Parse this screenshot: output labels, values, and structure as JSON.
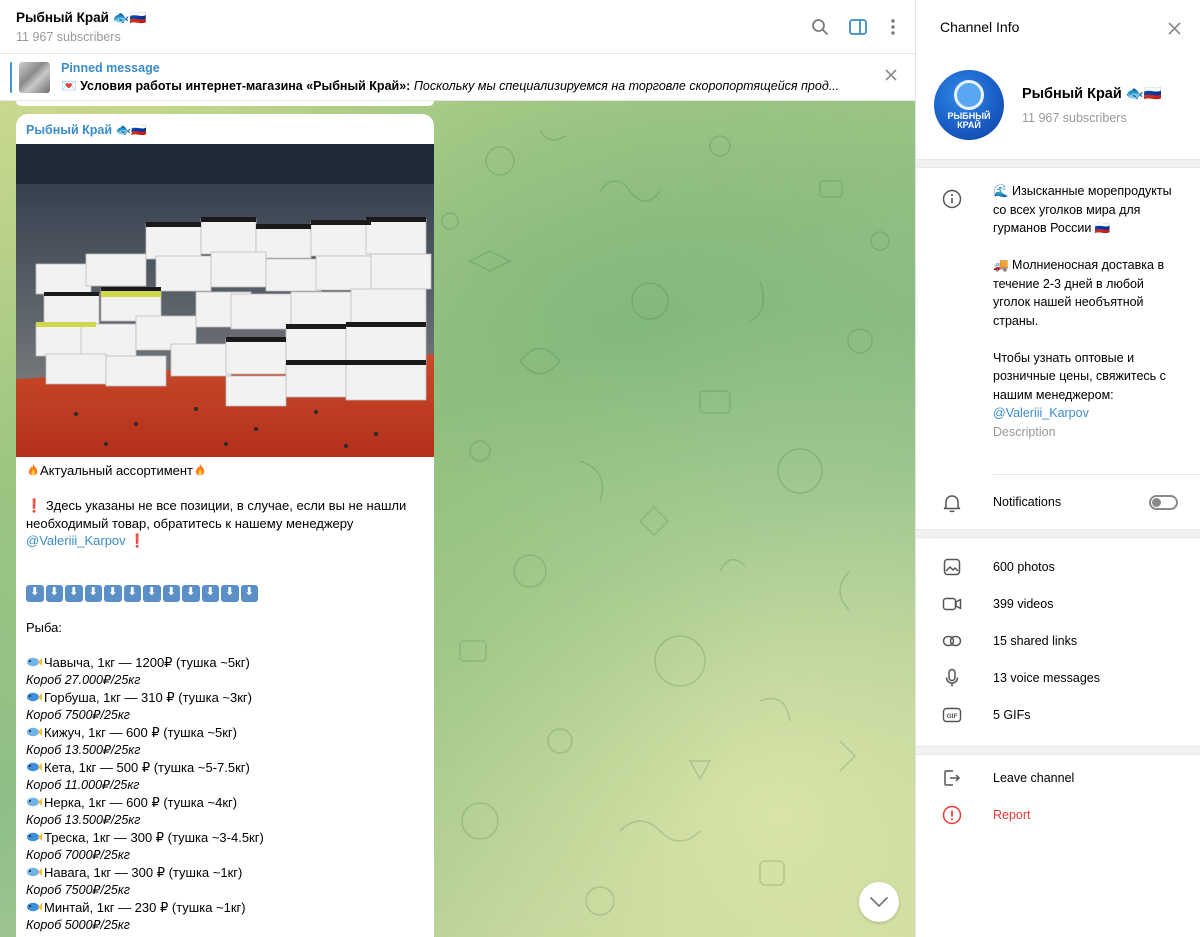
{
  "chat_header": {
    "title": "Рыбный Край 🐟🇷🇺",
    "subscribers": "11 967 subscribers"
  },
  "pinned": {
    "label": "Pinned message",
    "emoji": "💌",
    "bold_text": "Условия работы интернет-магазина «Рыбный Край»:",
    "italic_text": "Поскольку мы специализируемся на торговле скоропортящейся прод..."
  },
  "message": {
    "author": "Рыбный Край 🐟🇷🇺",
    "headline": "Актуальный ассортимент",
    "notice": "Здесь указаны не все позиции, в случае, если вы не нашли необходимый товар, обратитесь к нашему менеджеру",
    "notice_link": "@Valeriii_Karpov",
    "section": "Рыба:",
    "arrow_count": 12,
    "items": [
      {
        "name": "Чавыча, 1кг — 1200₽ (тушка ~5кг)",
        "box": "Короб 27.000₽/25кг"
      },
      {
        "name": "Горбуша, 1кг — 310 ₽ (тушка ~3кг)",
        "box": "Короб 7500₽/25кг"
      },
      {
        "name": "Кижуч, 1кг — 600 ₽ (тушка ~5кг)",
        "box": "Короб 13.500₽/25кг"
      },
      {
        "name": "Кета, 1кг — 500 ₽ (тушка ~5-7.5кг)",
        "box": "Короб 11.000₽/25кг"
      },
      {
        "name": "Нерка, 1кг — 600 ₽ (тушка ~4кг)",
        "box": "Короб 13.500₽/25кг"
      },
      {
        "name": "Треска, 1кг — 300 ₽ (тушка ~3-4.5кг)",
        "box": "Короб 7000₽/25кг"
      },
      {
        "name": "Навага, 1кг — 300 ₽ (тушка ~1кг)",
        "box": "Короб 7500₽/25кг"
      },
      {
        "name": "Минтай, 1кг — 230 ₽ (тушка ~1кг)",
        "box": "Короб 5000₽/25кг"
      }
    ]
  },
  "info_panel": {
    "title": "Channel Info",
    "name": "Рыбный Край 🐟🇷🇺",
    "subscribers": "11 967 subscribers",
    "avatar_text": [
      "РЫБНЫЙ",
      "КРАЙ"
    ],
    "description": {
      "p1": "🌊 Изысканные морепродукты со всех уголков мира для гурманов России 🇷🇺",
      "p2": "🚚 Молниеносная доставка в течение 2-3 дней в любой уголок нашей необъятной страны.",
      "p3": "Чтобы узнать оптовые и розничные цены, свяжитесь с нашим менеджером:",
      "link": "@Valeriii_Karpov",
      "label": "Description"
    },
    "notifications": {
      "label": "Notifications",
      "enabled": false
    },
    "media": [
      {
        "icon": "photo-icon",
        "label": "600 photos"
      },
      {
        "icon": "video-icon",
        "label": "399 videos"
      },
      {
        "icon": "link-icon",
        "label": "15 shared links"
      },
      {
        "icon": "microphone-icon",
        "label": "13 voice messages"
      },
      {
        "icon": "gif-icon",
        "label": "5 GIFs"
      }
    ],
    "actions": {
      "leave": "Leave channel",
      "report": "Report"
    }
  },
  "colors": {
    "accent": "#3a8bc8",
    "danger": "#e53935",
    "muted": "#999999"
  }
}
